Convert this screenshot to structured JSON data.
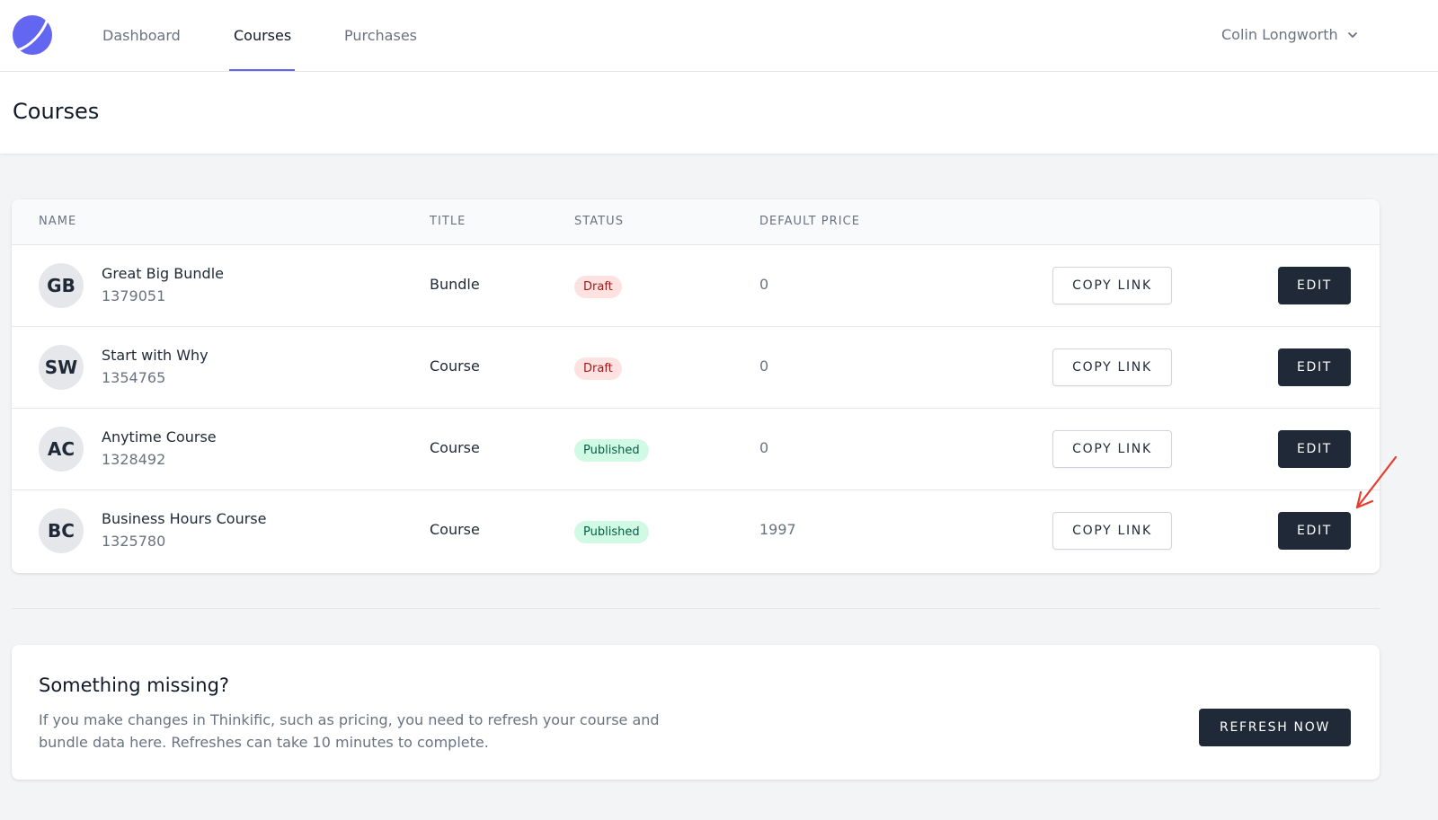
{
  "nav": {
    "items": [
      {
        "label": "Dashboard"
      },
      {
        "label": "Courses"
      },
      {
        "label": "Purchases"
      }
    ],
    "active": "Courses",
    "user_name": "Colin Longworth"
  },
  "page": {
    "title": "Courses"
  },
  "table": {
    "headers": [
      "Name",
      "Title",
      "Status",
      "Default Price"
    ],
    "rows": [
      {
        "initials": "GB",
        "name": "Great Big Bundle",
        "id": "1379051",
        "title": "Bundle",
        "status": "Draft",
        "price": "0",
        "copy_label": "COPY LINK",
        "edit_label": "EDIT"
      },
      {
        "initials": "SW",
        "name": "Start with Why",
        "id": "1354765",
        "title": "Course",
        "status": "Draft",
        "price": "0",
        "copy_label": "COPY LINK",
        "edit_label": "EDIT"
      },
      {
        "initials": "AC",
        "name": "Anytime Course",
        "id": "1328492",
        "title": "Course",
        "status": "Published",
        "price": "0",
        "copy_label": "COPY LINK",
        "edit_label": "EDIT"
      },
      {
        "initials": "BC",
        "name": "Business Hours Course",
        "id": "1325780",
        "title": "Course",
        "status": "Published",
        "price": "1997",
        "copy_label": "COPY LINK",
        "edit_label": "EDIT"
      }
    ]
  },
  "missing": {
    "title": "Something missing?",
    "text_line1": "If you make changes in Thinkific, such as pricing, you need to refresh your course and",
    "text_line2": "bundle data here. Refreshes can take 10 minutes to complete.",
    "button_label": "REFRESH NOW"
  },
  "colors": {
    "accent": "#6366f1",
    "dark_button": "#1f2937",
    "draft_bg": "#fee2e2",
    "draft_text": "#991b1b",
    "published_bg": "#d1fae5",
    "published_text": "#065f46",
    "annotation_arrow": "#e53e2f"
  },
  "icons": {
    "logo": "planet-logo-icon",
    "user_menu": "chevron-down-icon",
    "annotation": "red-arrow-annotation"
  }
}
